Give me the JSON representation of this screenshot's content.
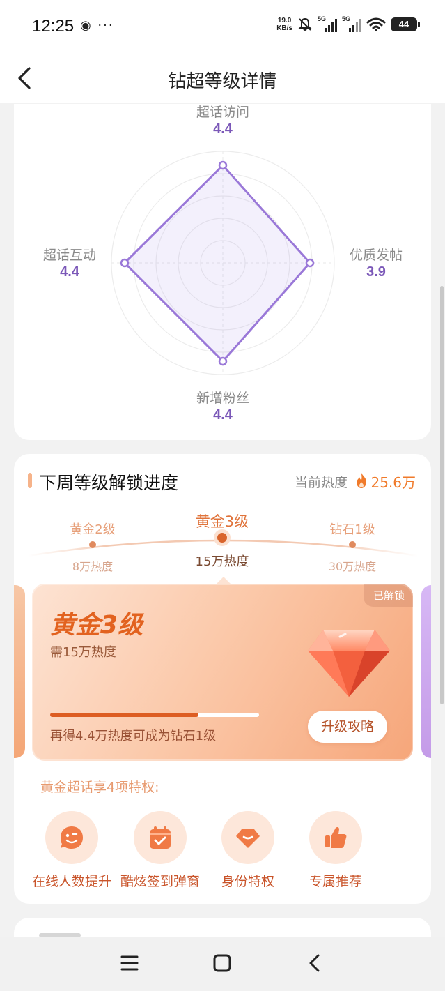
{
  "status_bar": {
    "time": "12:25",
    "left_icons": "◉ ···",
    "net_speed_value": "19.0",
    "net_speed_unit": "KB/s",
    "signal1_label": "5G",
    "signal2_label": "5G",
    "battery": "44"
  },
  "nav": {
    "title": "钻超等级详情"
  },
  "radar": {
    "dimensions": [
      {
        "label": "超话访问",
        "value": "4.4"
      },
      {
        "label": "优质发帖",
        "value": "3.9"
      },
      {
        "label": "新增粉丝",
        "value": "4.4"
      },
      {
        "label": "超话互动",
        "value": "4.4"
      }
    ]
  },
  "progress": {
    "title": "下周等级解锁进度",
    "current_heat_label": "当前热度",
    "current_heat_value": "25.6万",
    "levels": [
      {
        "name": "黄金2级",
        "heat": "8万热度"
      },
      {
        "name": "黄金3级",
        "heat": "15万热度"
      },
      {
        "name": "钻石1级",
        "heat": "30万热度"
      }
    ],
    "panel": {
      "badge": "已解锁",
      "level": "黄金3级",
      "requirement": "需15万热度",
      "progress_fraction": 0.71,
      "tip": "再得4.4万热度可成为钻石1级",
      "guide_button": "升级攻略"
    },
    "privileges_title": "黄金超话享4项特权:",
    "privileges": [
      {
        "label": "在线人数提升",
        "icon": "smile-face-icon"
      },
      {
        "label": "酷炫签到弹窗",
        "icon": "calendar-check-icon"
      },
      {
        "label": "身份特权",
        "icon": "gem-icon"
      },
      {
        "label": "专属推荐",
        "icon": "thumbs-up-icon"
      }
    ]
  },
  "colors": {
    "accent_orange": "#e2621f",
    "radar_purple": "#7b58b8",
    "heat_orange": "#f07a2a"
  }
}
